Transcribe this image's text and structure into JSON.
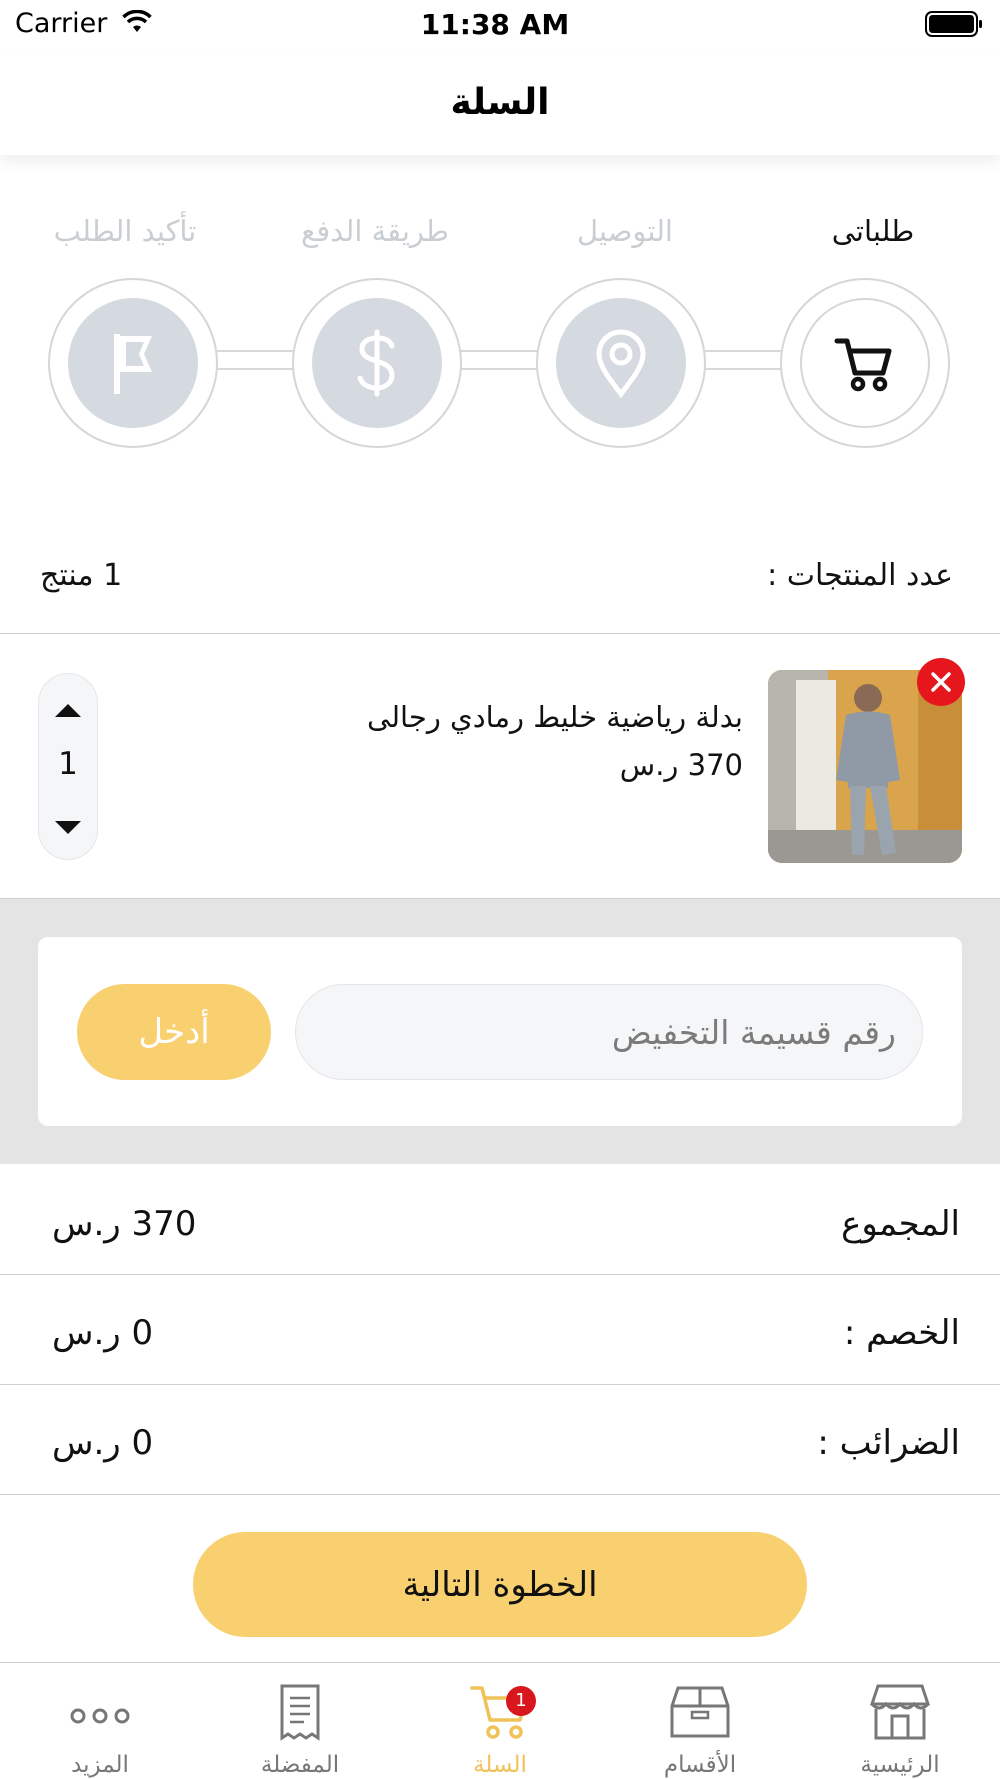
{
  "status_bar": {
    "carrier": "Carrier",
    "time": "11:38 AM"
  },
  "header": {
    "title": "السلة"
  },
  "steps": [
    {
      "label": "طلباتى",
      "icon": "cart-icon",
      "active": true
    },
    {
      "label": "التوصيل",
      "icon": "location-pin-icon",
      "active": false
    },
    {
      "label": "طريقة الدفع",
      "icon": "dollar-icon",
      "active": false
    },
    {
      "label": "تأكيد الطلب",
      "icon": "flag-icon",
      "active": false
    }
  ],
  "cart": {
    "count_label": "عدد المنتجات :",
    "count_value": "1",
    "count_unit": "منتج"
  },
  "product": {
    "name": "بدلة رياضية خليط رمادي رجالى",
    "price": "370 ر.س",
    "quantity": "1"
  },
  "coupon": {
    "placeholder": "رقم قسيمة التخفيض",
    "button_label": "أدخل"
  },
  "totals": {
    "subtotal_label": "المجموع",
    "subtotal_value": "370 ر.س",
    "discount_label": "الخصم :",
    "discount_value": "0 ر.س",
    "tax_label": "الضرائب :",
    "tax_value": "0 ر.س"
  },
  "next_button": "الخطوة التالية",
  "tabbar": {
    "items": [
      {
        "label": "الرئيسية",
        "icon": "store-icon"
      },
      {
        "label": "الأقسام",
        "icon": "box-icon"
      },
      {
        "label": "السلة",
        "icon": "cart-icon",
        "badge": "1",
        "active": true
      },
      {
        "label": "المفضلة",
        "icon": "document-icon"
      },
      {
        "label": "المزيد",
        "icon": "more-dots-icon"
      }
    ]
  },
  "colors": {
    "accent": "#f8d070",
    "active_tab": "#f0c257",
    "remove": "#e6161d",
    "step_inactive": "#d4dae0"
  }
}
